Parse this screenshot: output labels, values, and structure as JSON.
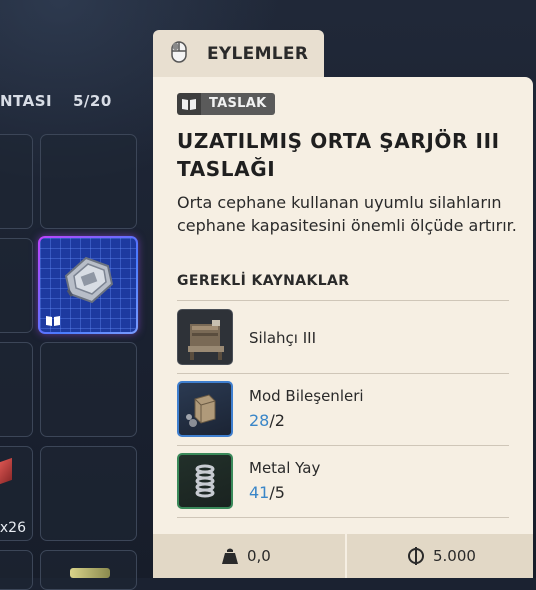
{
  "inventory": {
    "title_fragment": "NTASI",
    "count": "5/20",
    "stack_quantity": "x26"
  },
  "tooltip": {
    "tab_label": "EYLEMLER",
    "tab_icon": "mouse-icon",
    "category_badge": "TASLAK",
    "title": "UZATILMIŞ ORTA ŞARJÖR III TASLAĞI",
    "description": "Orta cephane kullanan uyumlu silahların cephane kapasitesini önemli ölçüde artırır.",
    "requirements_heading": "GEREKLİ KAYNAKLAR",
    "requirements": [
      {
        "name": "Silahçı III",
        "icon": "workbench-icon"
      },
      {
        "name": "Mod Bileşenleri",
        "have": "28",
        "need": "/2",
        "icon": "mod-components-icon"
      },
      {
        "name": "Metal Yay",
        "have": "41",
        "need": "/5",
        "icon": "metal-spring-icon"
      }
    ],
    "footer": {
      "weight": "0,0",
      "price": "5.000"
    }
  },
  "colors": {
    "panel_bg": "#f6efe3",
    "tab_bg": "#e8dfd0",
    "have_count": "#3a86c8",
    "selected_slot": "#1d3aa0"
  }
}
